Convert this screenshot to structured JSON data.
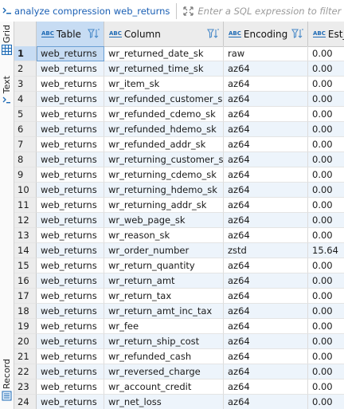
{
  "toolbar": {
    "query": "analyze compression web_returns",
    "filter_placeholder": "Enter a SQL expression to filter results (u"
  },
  "sidebar": {
    "tabs": [
      "Grid",
      "Text",
      "Record"
    ]
  },
  "grid": {
    "columns": [
      "Table",
      "Column",
      "Encoding",
      "Est_"
    ],
    "rows": [
      {
        "n": "1",
        "table": "web_returns",
        "column": "wr_returned_date_sk",
        "encoding": "raw",
        "est": "0.00"
      },
      {
        "n": "2",
        "table": "web_returns",
        "column": "wr_returned_time_sk",
        "encoding": "az64",
        "est": "0.00"
      },
      {
        "n": "3",
        "table": "web_returns",
        "column": "wr_item_sk",
        "encoding": "az64",
        "est": "0.00"
      },
      {
        "n": "4",
        "table": "web_returns",
        "column": "wr_refunded_customer_sk",
        "encoding": "az64",
        "est": "0.00"
      },
      {
        "n": "5",
        "table": "web_returns",
        "column": "wr_refunded_cdemo_sk",
        "encoding": "az64",
        "est": "0.00"
      },
      {
        "n": "6",
        "table": "web_returns",
        "column": "wr_refunded_hdemo_sk",
        "encoding": "az64",
        "est": "0.00"
      },
      {
        "n": "7",
        "table": "web_returns",
        "column": "wr_refunded_addr_sk",
        "encoding": "az64",
        "est": "0.00"
      },
      {
        "n": "8",
        "table": "web_returns",
        "column": "wr_returning_customer_sk",
        "encoding": "az64",
        "est": "0.00"
      },
      {
        "n": "9",
        "table": "web_returns",
        "column": "wr_returning_cdemo_sk",
        "encoding": "az64",
        "est": "0.00"
      },
      {
        "n": "10",
        "table": "web_returns",
        "column": "wr_returning_hdemo_sk",
        "encoding": "az64",
        "est": "0.00"
      },
      {
        "n": "11",
        "table": "web_returns",
        "column": "wr_returning_addr_sk",
        "encoding": "az64",
        "est": "0.00"
      },
      {
        "n": "12",
        "table": "web_returns",
        "column": "wr_web_page_sk",
        "encoding": "az64",
        "est": "0.00"
      },
      {
        "n": "13",
        "table": "web_returns",
        "column": "wr_reason_sk",
        "encoding": "az64",
        "est": "0.00"
      },
      {
        "n": "14",
        "table": "web_returns",
        "column": "wr_order_number",
        "encoding": "zstd",
        "est": "15.64"
      },
      {
        "n": "15",
        "table": "web_returns",
        "column": "wr_return_quantity",
        "encoding": "az64",
        "est": "0.00"
      },
      {
        "n": "16",
        "table": "web_returns",
        "column": "wr_return_amt",
        "encoding": "az64",
        "est": "0.00"
      },
      {
        "n": "17",
        "table": "web_returns",
        "column": "wr_return_tax",
        "encoding": "az64",
        "est": "0.00"
      },
      {
        "n": "18",
        "table": "web_returns",
        "column": "wr_return_amt_inc_tax",
        "encoding": "az64",
        "est": "0.00"
      },
      {
        "n": "19",
        "table": "web_returns",
        "column": "wr_fee",
        "encoding": "az64",
        "est": "0.00"
      },
      {
        "n": "20",
        "table": "web_returns",
        "column": "wr_return_ship_cost",
        "encoding": "az64",
        "est": "0.00"
      },
      {
        "n": "21",
        "table": "web_returns",
        "column": "wr_refunded_cash",
        "encoding": "az64",
        "est": "0.00"
      },
      {
        "n": "22",
        "table": "web_returns",
        "column": "wr_reversed_charge",
        "encoding": "az64",
        "est": "0.00"
      },
      {
        "n": "23",
        "table": "web_returns",
        "column": "wr_account_credit",
        "encoding": "az64",
        "est": "0.00"
      },
      {
        "n": "24",
        "table": "web_returns",
        "column": "wr_net_loss",
        "encoding": "az64",
        "est": "0.00"
      }
    ]
  },
  "icons": {
    "query": "sql-query-icon",
    "filter": "filter-expand-icon",
    "grid": "grid-icon",
    "text": "text-icon",
    "record": "record-icon",
    "column_type": "abc-type-icon",
    "column_filter": "column-filter-icon"
  },
  "colors": {
    "selection": "#c7dcf3",
    "alt_row": "#edf4fb",
    "header": "#ececec",
    "query_text": "#1a5fb4"
  }
}
